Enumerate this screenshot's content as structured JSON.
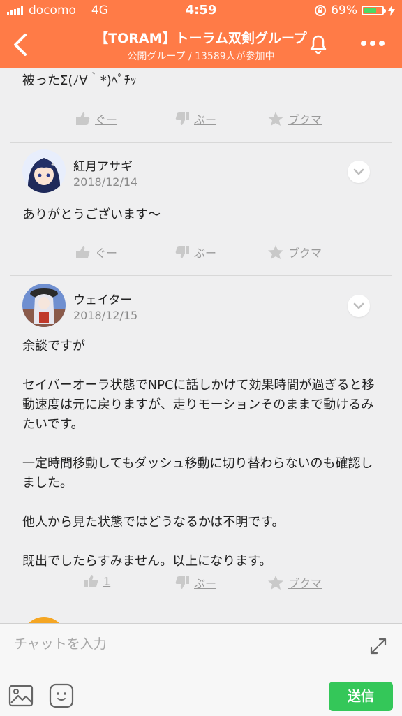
{
  "status_bar": {
    "carrier": "docomo",
    "network": "4G",
    "time": "4:59",
    "battery_percent_label": "69%",
    "battery_level": 0.69
  },
  "header": {
    "title": "【TORAM】トーラム双剣グループ",
    "subtitle": "公開グループ / 13589人が参加中"
  },
  "posts": [
    {
      "text": "被ったΣ(ﾉ∀｀*)ﾍﾟﾁｯ",
      "actions": {
        "like": "ぐー",
        "dislike": "ぶー",
        "bookmark": "ブクマ"
      }
    },
    {
      "author": "紅月アサギ",
      "date": "2018/12/14",
      "text": "ありがとうございます〜",
      "actions": {
        "like": "ぐー",
        "dislike": "ぶー",
        "bookmark": "ブクマ"
      }
    },
    {
      "author": "ウェイター",
      "date": "2018/12/15",
      "text": "余談ですが\n\nセイバーオーラ状態でNPCに話しかけて効果時間が過ぎると移動速度は元に戻りますが、走りモーションそのままで動けるみたいです。\n\n一定時間移動してもダッシュ移動に切り替わらないのも確認しました。\n\n他人から見た状態ではどうなるかは不明です。\n\n既出でしたらすみません。以上になります。",
      "actions": {
        "like": "1",
        "dislike": "ぶー",
        "bookmark": "ブクマ"
      }
    }
  ],
  "composer": {
    "placeholder": "チャットを入力",
    "send_label": "送信"
  },
  "colors": {
    "header_bg": "#ff7b47",
    "send_bg": "#34c759",
    "background": "#efeff0"
  }
}
